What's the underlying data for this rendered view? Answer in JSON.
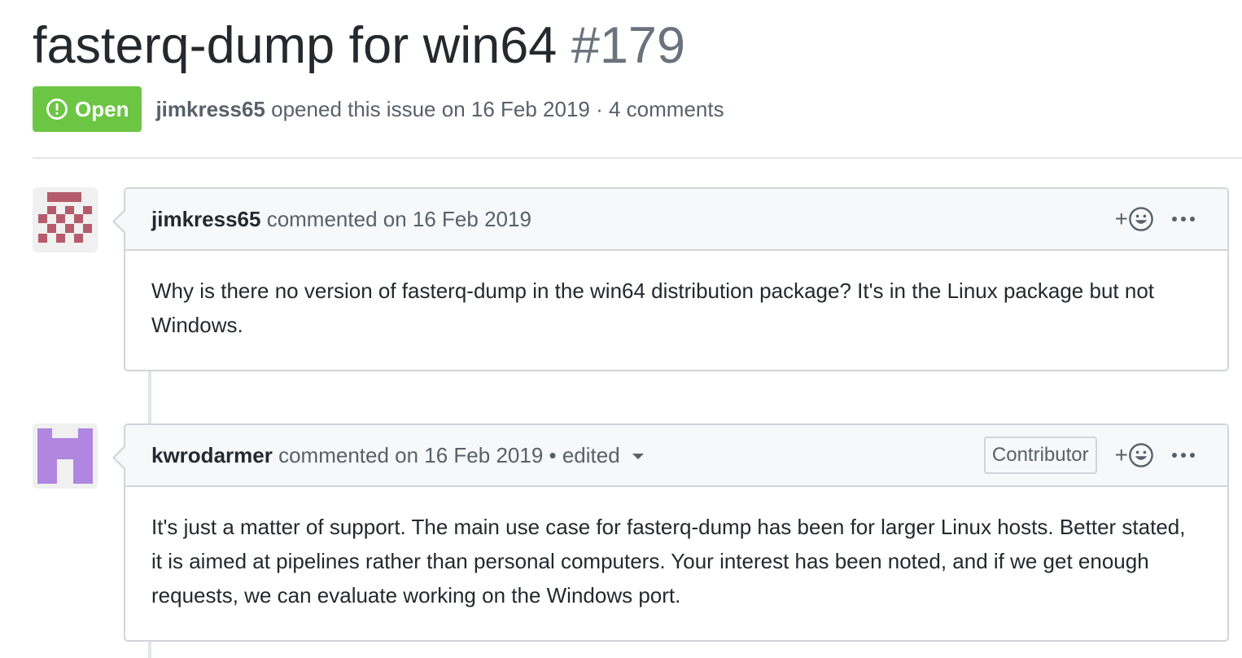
{
  "issue": {
    "title": "fasterq-dump for win64",
    "number": "#179",
    "state": "Open",
    "author": "jimkress65",
    "opened_text": "opened this issue on 16 Feb 2019 · 4 comments"
  },
  "comments": [
    {
      "author": "jimkress65",
      "meta": "commented on 16 Feb 2019",
      "avatar_color": "#b55c6c",
      "body": "Why is there no version of fasterq-dump in the win64 distribution package? It's in the Linux package but not Windows."
    },
    {
      "author": "kwrodarmer",
      "meta": "commented on 16 Feb 2019 • edited",
      "badge": "Contributor",
      "avatar_color": "#b086e0",
      "body": "It's just a matter of support. The main use case for fasterq-dump has been for larger Linux hosts. Better stated, it is aimed at pipelines rather than personal computers. Your interest has been noted, and if we get enough requests, we can evaluate working on the Windows port."
    }
  ],
  "icons": {
    "state": "issue-opened-icon",
    "reaction": "smiley-icon",
    "more": "kebab-horizontal-icon",
    "edited": "triangle-down-icon"
  },
  "colors": {
    "open_state": "#6cc644"
  }
}
